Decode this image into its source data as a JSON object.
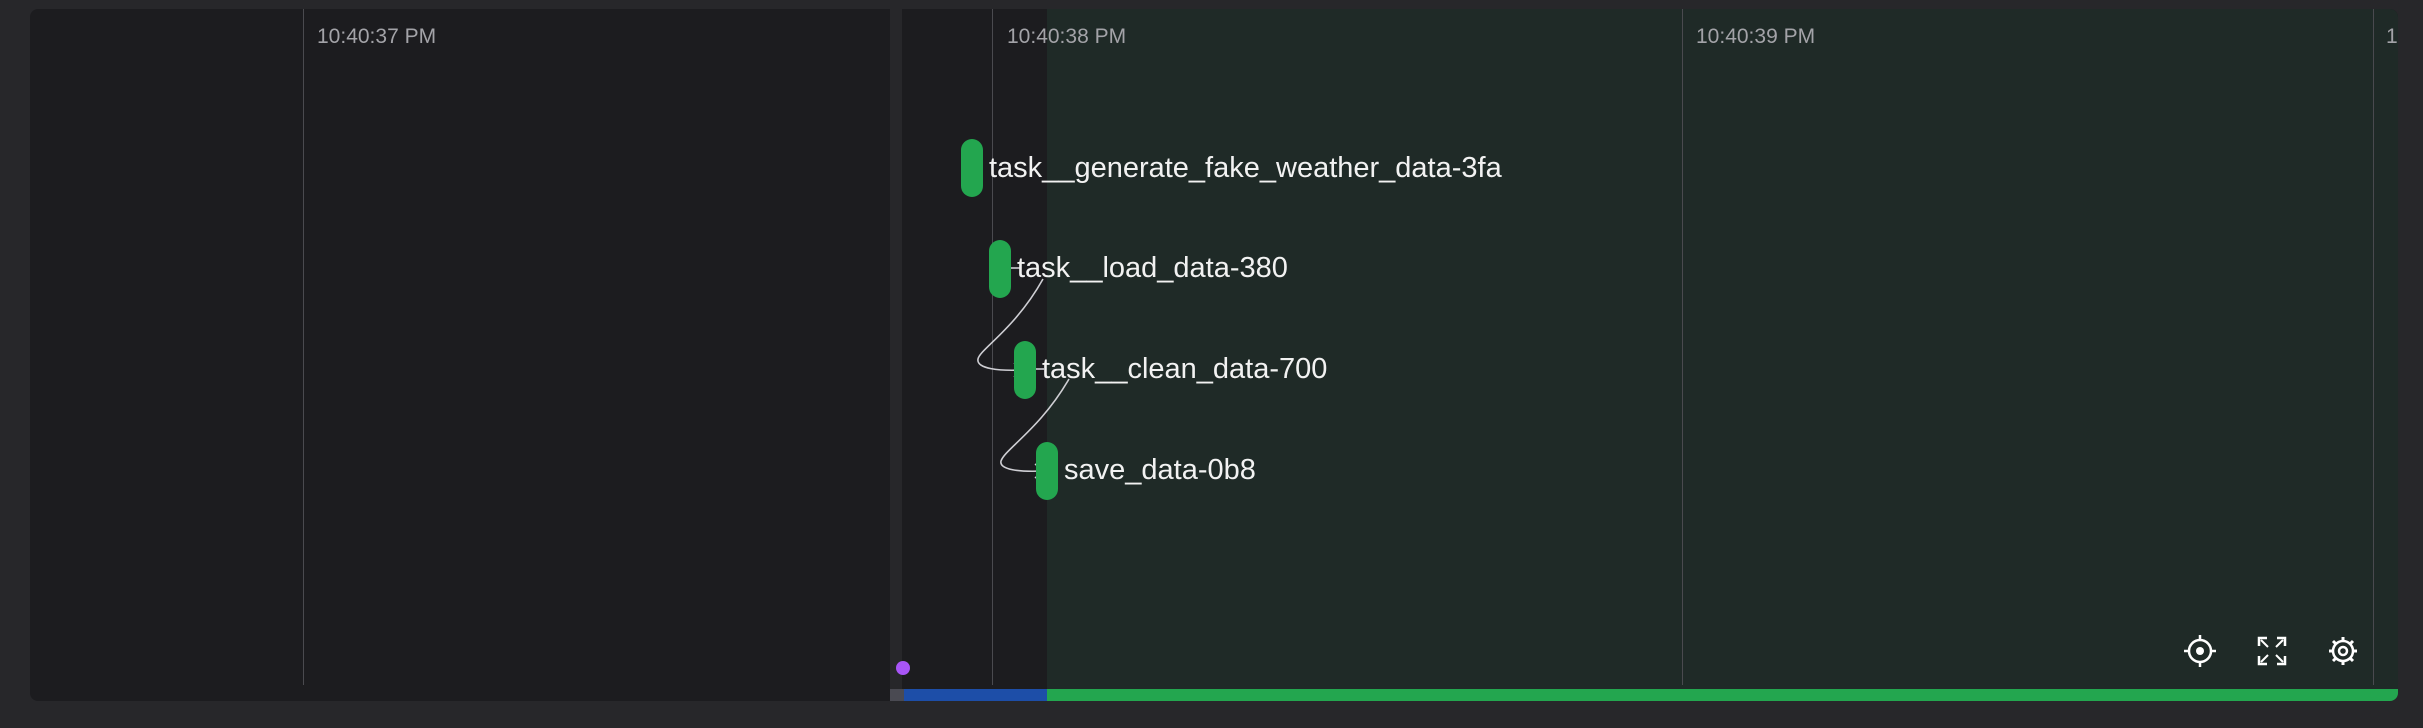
{
  "timeline": {
    "time_labels": [
      "10:40:37 PM",
      "10:40:38 PM",
      "10:40:39 PM",
      "1"
    ],
    "nodes": [
      {
        "label": "task__generate_fake_weather_data-3fa",
        "status_color": "#23a64f"
      },
      {
        "label": "task__load_data-380",
        "status_color": "#23a64f"
      },
      {
        "label": "task__clean_data-700",
        "status_color": "#23a64f"
      },
      {
        "label": "save_data-0b8",
        "status_color": "#23a64f"
      }
    ],
    "edges": [
      {
        "from": "task__load_data-380",
        "to": "task__clean_data-700"
      },
      {
        "from": "task__clean_data-700",
        "to": "save_data-0b8"
      }
    ]
  },
  "controls": {
    "center_icon": "crosshair-icon",
    "fullscreen_icon": "expand-icon",
    "settings_icon": "gear-icon"
  },
  "colors": {
    "completed": "#23a64f",
    "scheduled": "#1d4ea8",
    "marker": "#a855f7",
    "background": "#1c1c1f"
  }
}
